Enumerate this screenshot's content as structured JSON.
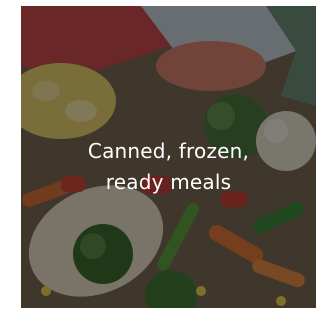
{
  "tile": {
    "line1": "Canned, frozen,",
    "line2": "ready meals"
  },
  "colors": {
    "overlay": "#000000",
    "caption_text": "#ffffff"
  },
  "icons": {
    "background": "food-photo-icon"
  }
}
